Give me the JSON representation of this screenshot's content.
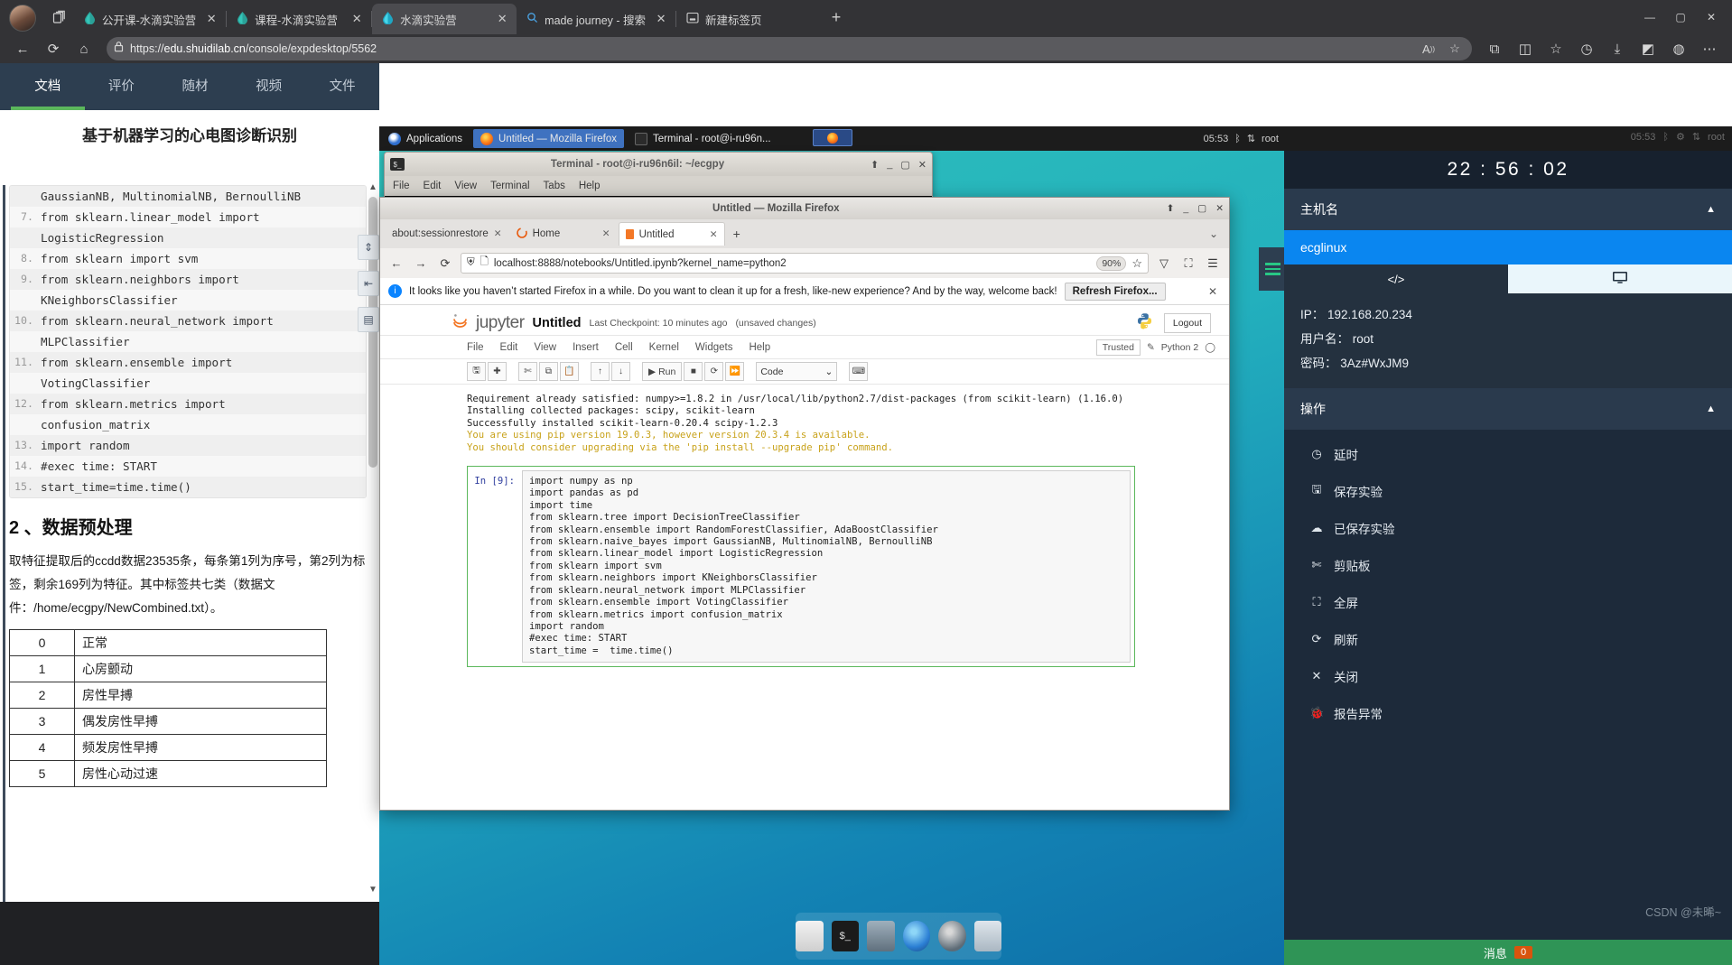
{
  "browser": {
    "tabs": [
      {
        "label": "公开课-水滴实验营",
        "icon": "droplet-icon",
        "active": false,
        "closable": true
      },
      {
        "label": "课程-水滴实验营",
        "icon": "droplet-icon",
        "active": false,
        "closable": true
      },
      {
        "label": "水滴实验营",
        "icon": "droplet-icon",
        "active": true,
        "closable": true
      },
      {
        "label": "made journey - 搜索",
        "icon": "search-icon",
        "active": false,
        "closable": true
      },
      {
        "label": "新建标签页",
        "icon": "newtab-icon",
        "active": false,
        "closable": false
      }
    ],
    "new_tab_label": "+",
    "url_scheme": "https://",
    "url_domain": "edu.shuidilab.cn",
    "url_path": "/console/expdesktop/5562",
    "window_buttons": [
      "—",
      "▢",
      "✕"
    ]
  },
  "course": {
    "tabs": [
      {
        "label": "文档",
        "active": true
      },
      {
        "label": "评价",
        "active": false
      },
      {
        "label": "随材",
        "active": false
      },
      {
        "label": "视频",
        "active": false
      },
      {
        "label": "文件",
        "active": false
      }
    ],
    "title": "基于机器学习的心电图诊断识别",
    "code_lines": [
      {
        "num": "",
        "text": "GaussianNB, MultinomialNB, BernoulliNB",
        "cls": "cls"
      },
      {
        "num": "7.",
        "text": "from sklearn.linear_model import"
      },
      {
        "num": "",
        "text": "LogisticRegression",
        "cls": "cls"
      },
      {
        "num": "8.",
        "text": "from sklearn import svm"
      },
      {
        "num": "9.",
        "text": "from sklearn.neighbors import"
      },
      {
        "num": "",
        "text": "KNeighborsClassifier",
        "cls": "cls"
      },
      {
        "num": "10.",
        "text": "from sklearn.neural_network import"
      },
      {
        "num": "",
        "text": "MLPClassifier",
        "cls": "cls"
      },
      {
        "num": "11.",
        "text": "from sklearn.ensemble import"
      },
      {
        "num": "",
        "text": "VotingClassifier",
        "cls": "cls"
      },
      {
        "num": "12.",
        "text": "from sklearn.metrics import"
      },
      {
        "num": "",
        "text": "confusion_matrix",
        "cls": "cls"
      },
      {
        "num": "13.",
        "text": "import random"
      },
      {
        "num": "14.",
        "text": "#exec time: START",
        "cls": "cmt"
      },
      {
        "num": "15.",
        "text": "start_time=time.time()"
      }
    ],
    "section_heading": "2 、数据预处理",
    "paragraph": "取特征提取后的ccdd数据23535条，每条第1列为序号，第2列为标签，剩余169列为特征。其中标签共七类（数据文件：/home/ecgpy/NewCombined.txt）。",
    "label_table": [
      {
        "idx": "0",
        "name": "正常"
      },
      {
        "idx": "1",
        "name": "心房颤动"
      },
      {
        "idx": "2",
        "name": "房性早搏"
      },
      {
        "idx": "3",
        "name": "偶发房性早搏"
      },
      {
        "idx": "4",
        "name": "频发房性早搏"
      },
      {
        "idx": "5",
        "name": "房性心动过速"
      }
    ]
  },
  "desktop": {
    "panel": {
      "applications_label": "Applications",
      "windows": [
        {
          "label": "Untitled — Mozilla Firefox",
          "active": true,
          "icon": "firefox-icon"
        },
        {
          "label": "Terminal - root@i-ru96n...",
          "active": false,
          "icon": "terminal-icon"
        }
      ],
      "tray_time": "05:53",
      "tray_user": "root"
    },
    "terminal": {
      "title": "Terminal - root@i-ru96n6il: ~/ecgpy",
      "menu": [
        "File",
        "Edit",
        "View",
        "Terminal",
        "Tabs",
        "Help"
      ],
      "buttons": [
        "⬆",
        "_",
        "▢",
        "✕"
      ]
    },
    "firefox": {
      "title": "Untitled — Mozilla Firefox",
      "buttons": [
        "⬆",
        "_",
        "▢",
        "✕"
      ],
      "tabs": [
        {
          "label": "about:sessionrestore",
          "active": false
        },
        {
          "label": "Home",
          "active": false
        },
        {
          "label": "Untitled",
          "active": true
        }
      ],
      "new_tab": "+",
      "url": "localhost:8888/notebooks/Untitled.ipynb?kernel_name=python2",
      "zoom": "90%",
      "notification": "It looks like you haven’t started Firefox in a while. Do you want to clean it up for a fresh, like-new experience? And by the way, welcome back!",
      "notification_button": "Refresh Firefox...",
      "notification_close": "✕"
    },
    "jupyter": {
      "logo_text": "jupyter",
      "notebook_name": "Untitled",
      "checkpoint": "Last Checkpoint: 10 minutes ago",
      "dirty": "(unsaved changes)",
      "logout_label": "Logout",
      "menu": [
        "File",
        "Edit",
        "View",
        "Insert",
        "Cell",
        "Kernel",
        "Widgets",
        "Help"
      ],
      "trusted_label": "Trusted",
      "kernel_label": "Python 2",
      "run_label": "Run",
      "cell_type": "Code",
      "output_lines": [
        {
          "text": "Requirement already satisfied: numpy>=1.8.2 in /usr/local/lib/python2.7/dist-packages (from scikit-learn) (1.16.0)",
          "kind": "plain"
        },
        {
          "text": "Installing collected packages: scipy, scikit-learn",
          "kind": "plain"
        },
        {
          "text": "Successfully installed scikit-learn-0.20.4 scipy-1.2.3",
          "kind": "plain"
        },
        {
          "text": "You are using pip version 19.0.3, however version 20.3.4 is available.",
          "kind": "warn"
        },
        {
          "text": "You should consider upgrading via the 'pip install --upgrade pip' command.",
          "kind": "warn"
        }
      ],
      "cell_prompt": "In [9]:",
      "cell_source": "import numpy as np\nimport pandas as pd\nimport time\nfrom sklearn.tree import DecisionTreeClassifier\nfrom sklearn.ensemble import RandomForestClassifier, AdaBoostClassifier\nfrom sklearn.naive_bayes import GaussianNB, MultinomialNB, BernoulliNB\nfrom sklearn.linear_model import LogisticRegression\nfrom sklearn import svm\nfrom sklearn.neighbors import KNeighborsClassifier\nfrom sklearn.neural_network import MLPClassifier\nfrom sklearn.ensemble import VotingClassifier\nfrom sklearn.metrics import confusion_matrix\nimport random\n#exec time: START\nstart_time =  time.time()"
    }
  },
  "sidebar": {
    "clock": "22 : 56 : 02",
    "host_section": "主机名",
    "hostname": "ecglinux",
    "mode_code": "</>",
    "mode_screen": "screen-icon",
    "info": [
      {
        "key": "IP：",
        "value": "192.168.20.234"
      },
      {
        "key": "用户名：",
        "value": "root"
      },
      {
        "key": "密码：",
        "value": "3Az#WxJM9"
      }
    ],
    "actions_section": "操作",
    "actions": [
      {
        "icon": "clock-icon",
        "label": "延时",
        "glyph": "◷"
      },
      {
        "icon": "save-icon",
        "label": "保存实验",
        "glyph": "🖫"
      },
      {
        "icon": "cloud-icon",
        "label": "已保存实验",
        "glyph": "☁"
      },
      {
        "icon": "scissors-icon",
        "label": "剪贴板",
        "glyph": "✄"
      },
      {
        "icon": "fullscreen-icon",
        "label": "全屏",
        "glyph": "⛶"
      },
      {
        "icon": "refresh-icon",
        "label": "刷新",
        "glyph": "⟳"
      },
      {
        "icon": "close-icon",
        "label": "关闭",
        "glyph": "✕"
      },
      {
        "icon": "bug-icon",
        "label": "报告异常",
        "glyph": "🐞"
      }
    ],
    "watermark": "CSDN @未晞~",
    "message_label": "消息",
    "message_count": "0"
  },
  "colors": {
    "accent_green": "#5cb85c",
    "brand_blue": "#0a86f0",
    "sidebar_bg": "#1d2a3a",
    "desktop_teal": "#23b0bd",
    "message_green": "#2f9456"
  }
}
